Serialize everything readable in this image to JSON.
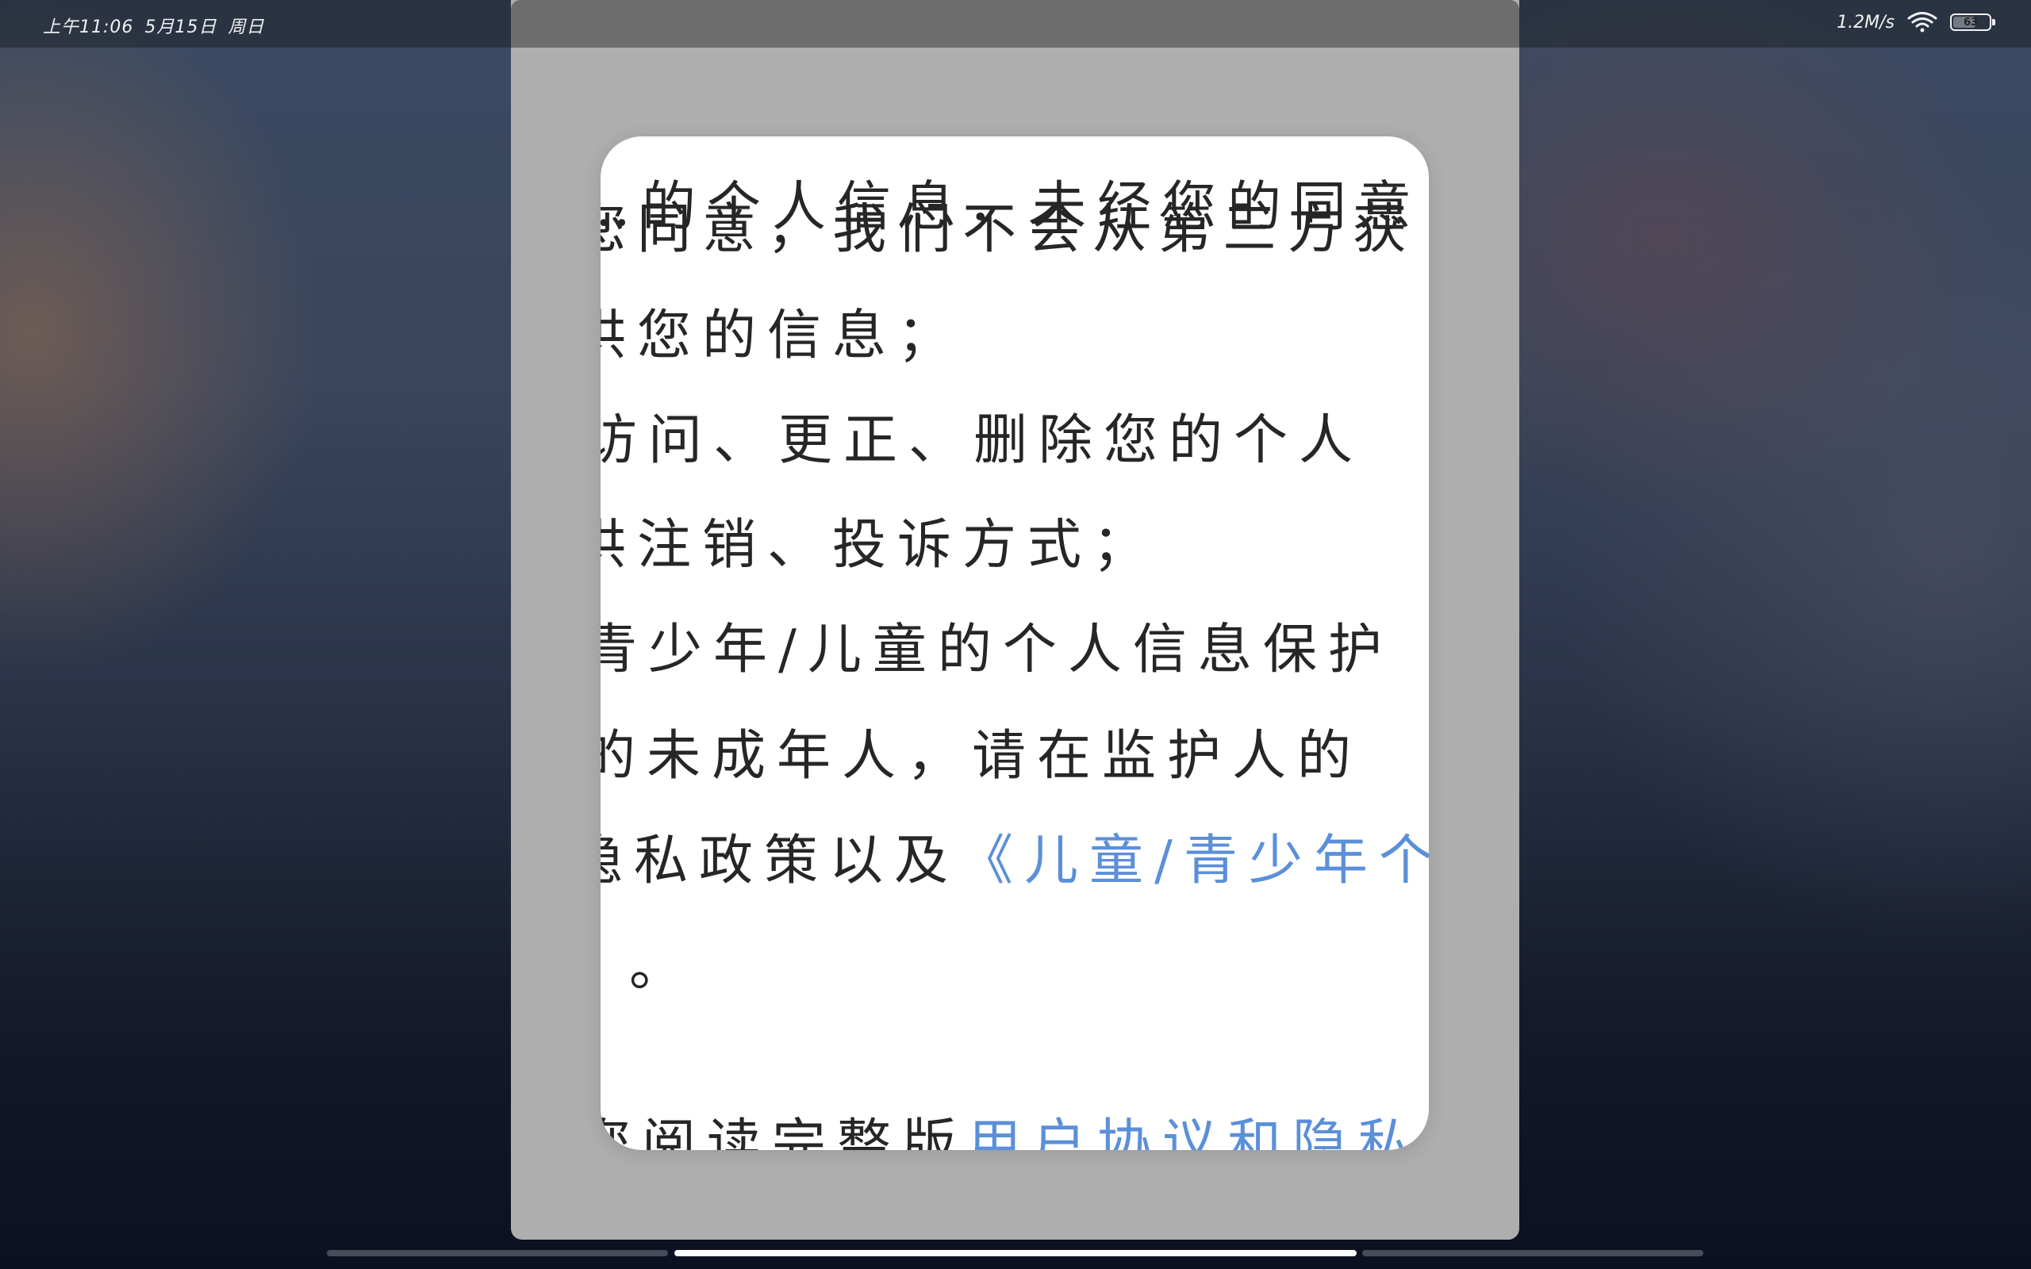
{
  "status_bar": {
    "time": "上午11:06",
    "date": "5月15日",
    "weekday": "周日",
    "network_speed": "1.2M/s",
    "battery_level": "63",
    "battery_fraction": 0.63
  },
  "dialog": {
    "lines": [
      {
        "text": "…的个人信息，未经您的同意",
        "link": ""
      },
      {
        "text": "您同意，我们不会从第三方获",
        "link": ""
      },
      {
        "text": "供您的信息；",
        "link": ""
      },
      {
        "text": "访问、更正、删除您的个人",
        "link": ""
      },
      {
        "text": "供注销、投诉方式；",
        "link": ""
      },
      {
        "text": "青少年/儿童的个人信息保护",
        "link": ""
      },
      {
        "text": "的未成年人，请在监护人的",
        "link": ""
      },
      {
        "text": "隐私政策以及",
        "link": "《儿童/青少年个"
      },
      {
        "text": "",
        "link": "》"
      },
      {
        "text": "。",
        "link": ""
      },
      {
        "text": "您阅读完整版",
        "link": "用户协议和隐私"
      }
    ]
  },
  "icons": {
    "wifi": "wifi-icon",
    "battery": "battery-icon"
  },
  "colors": {
    "link": "#5b8fd9",
    "text": "#262626",
    "dim_overlay": "#aeaeae",
    "card": "#ffffff"
  }
}
